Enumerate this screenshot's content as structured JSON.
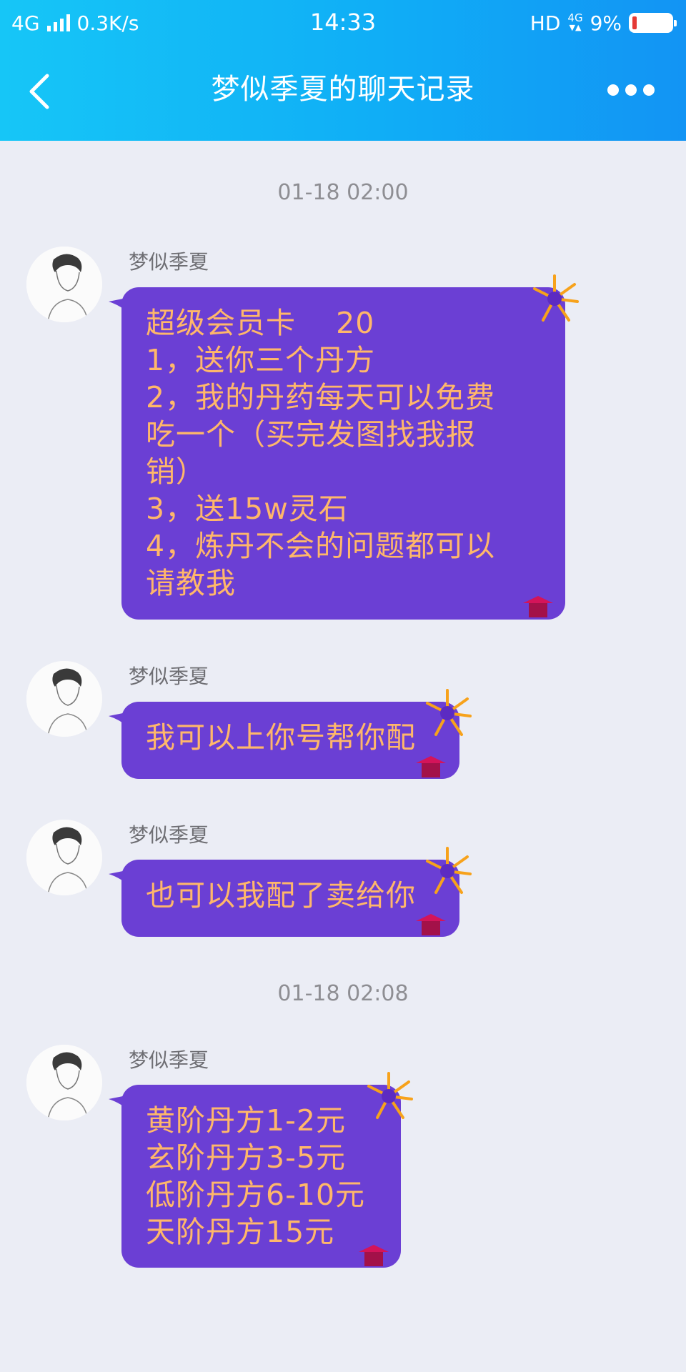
{
  "status_bar": {
    "network": "4G",
    "speed": "0.3K/s",
    "time": "14:33",
    "hd": "HD",
    "net_mini_top": "4G",
    "battery": "9%"
  },
  "header": {
    "title": "梦似季夏的聊天记录"
  },
  "timestamps": [
    "01-18 02:00",
    "01-18 02:08"
  ],
  "messages": [
    {
      "sender": "梦似季夏",
      "lines": [
        "超级会员卡    20",
        "1，送你三个丹方",
        "2，我的丹药每天可以免费",
        "吃一个（买完发图找我报",
        "销）",
        "3，送15w灵石",
        "4，炼丹不会的问题都可以",
        "请教我"
      ]
    },
    {
      "sender": "梦似季夏",
      "lines": [
        "我可以上你号帮你配"
      ]
    },
    {
      "sender": "梦似季夏",
      "lines": [
        "也可以我配了卖给你"
      ]
    },
    {
      "sender": "梦似季夏",
      "lines": [
        "黄阶丹方1-2元",
        "玄阶丹方3-5元",
        "低阶丹方6-10元",
        "天阶丹方15元"
      ]
    }
  ],
  "colors": {
    "header_gradient_start": "#16c6f7",
    "header_gradient_end": "#1294f4",
    "background": "#ebedf5",
    "bubble": "#6b3fd4",
    "bubble_text": "#ffb76a"
  },
  "icons": {
    "back": "chevron-left-icon",
    "more": "more-dots-icon",
    "avatar": "avatar-sketch",
    "decoration": "firework-icon"
  }
}
